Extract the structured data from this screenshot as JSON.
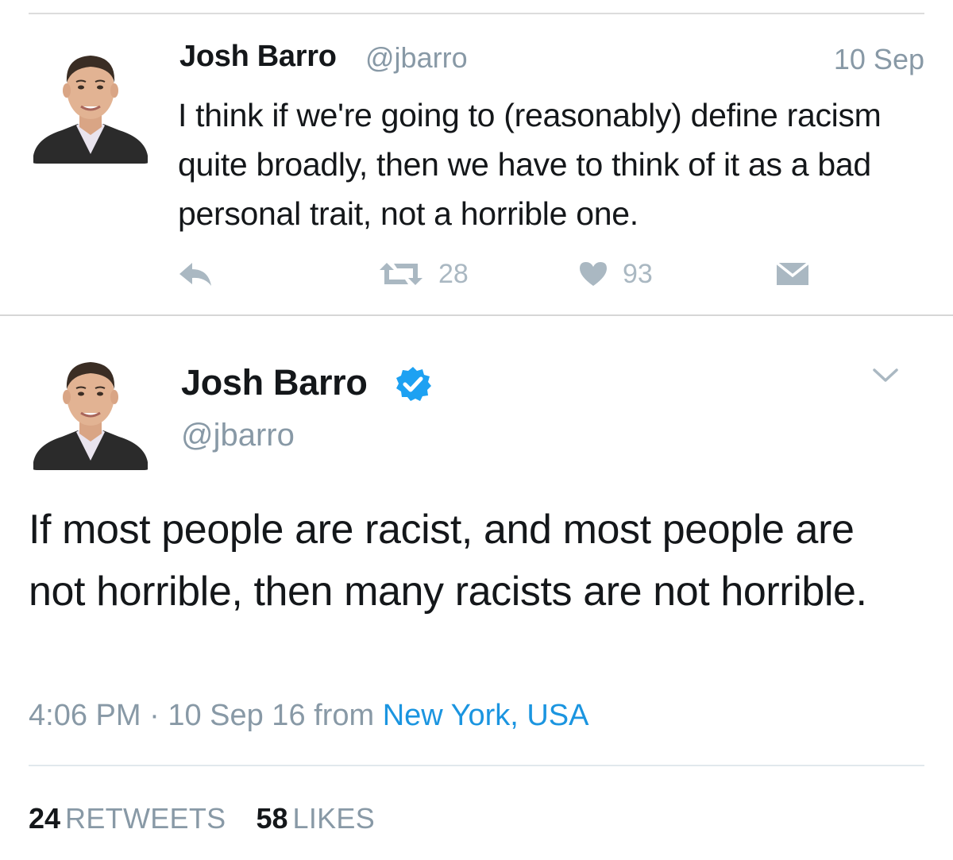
{
  "tweet1": {
    "name": "Josh Barro",
    "handle": "@jbarro",
    "date": "10 Sep",
    "text": "I think if we're going to (reasonably) define racism quite broadly, then we have to think of it as a bad personal trait, not a horrible one.",
    "retweet_count": "28",
    "like_count": "93"
  },
  "tweet2": {
    "name": "Josh Barro",
    "handle": "@jbarro",
    "text": "If most people are racist, and most people are not horrible, then many racists are not horrible.",
    "time": "4:06 PM",
    "separator": "·",
    "date": "10 Sep 16",
    "from_label": "from",
    "location": "New York, USA",
    "retweets_count": "24",
    "retweets_label": "RETWEETS",
    "likes_count": "58",
    "likes_label": "LIKES"
  },
  "colors": {
    "text": "#14171a",
    "secondary": "#8899a6",
    "link": "#1b95e0",
    "icon": "#aab8c2",
    "verified": "#1da1f2"
  },
  "icons": {
    "reply": "reply-icon",
    "retweet": "retweet-icon",
    "like": "heart-icon",
    "dm": "envelope-icon",
    "verified": "verified-badge-icon",
    "more": "chevron-down-icon"
  }
}
